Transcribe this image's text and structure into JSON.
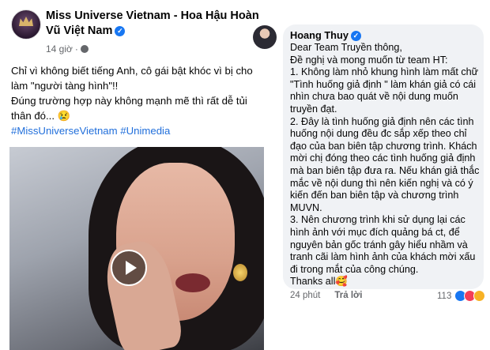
{
  "post": {
    "page_name": "Miss Universe Vietnam - Hoa Hậu Hoàn Vũ Việt Nam",
    "time": "14 giờ",
    "text_line1": "Chỉ vì không biết tiếng Anh, cô gái bật khóc vì bị cho làm \"người tàng hình\"!!",
    "text_line2": "Đúng trường hợp này không mạnh mẽ thì rất dễ tủi thân đó... 😢",
    "hashtags": "#MissUniverseVietnam #Unimedia"
  },
  "comment": {
    "author": "Hoang Thuy",
    "paragraphs": [
      "Dear Team Truyền thông,",
      "Đề nghị và mong muốn từ team HT:",
      "1. Không làm nhỏ khung hình làm mất chữ \"Tình huống giả định \" làm khán giả có cái nhìn chưa bao quát về nội dung muốn truyền đạt.",
      "2. Đây là tình huống giả định nên các tình huống nội dung đều đc sắp xếp theo chỉ đạo của ban biên tập chương trình. Khách mời chị đóng theo các tình huống giả định mà ban biên tập đưa ra. Nếu khán giả thắc mắc về nội dung thì nên kiến nghị và có  ý kiến đến ban biên tập và chương trình MUVN.",
      "3. Nên chương trình khi sử dụng lại các hình ảnh với mục đích quảng bá ct,  để nguyên bản gốc tránh gây hiểu nhầm và tranh cãi làm hình ảnh của khách mời xấu đi trong mắt của công chúng.",
      "Thanks all🥰"
    ],
    "time": "24 phút",
    "reply_label": "Trả lời",
    "reaction_count": "113"
  },
  "colors": {
    "link": "#216fdb",
    "verified": "#1877f2",
    "muted": "#65676b",
    "bubble": "#f0f2f5"
  },
  "icons": [
    "verified-icon",
    "globe-icon",
    "play-icon",
    "like-reaction-icon",
    "love-reaction-icon",
    "wow-reaction-icon"
  ]
}
